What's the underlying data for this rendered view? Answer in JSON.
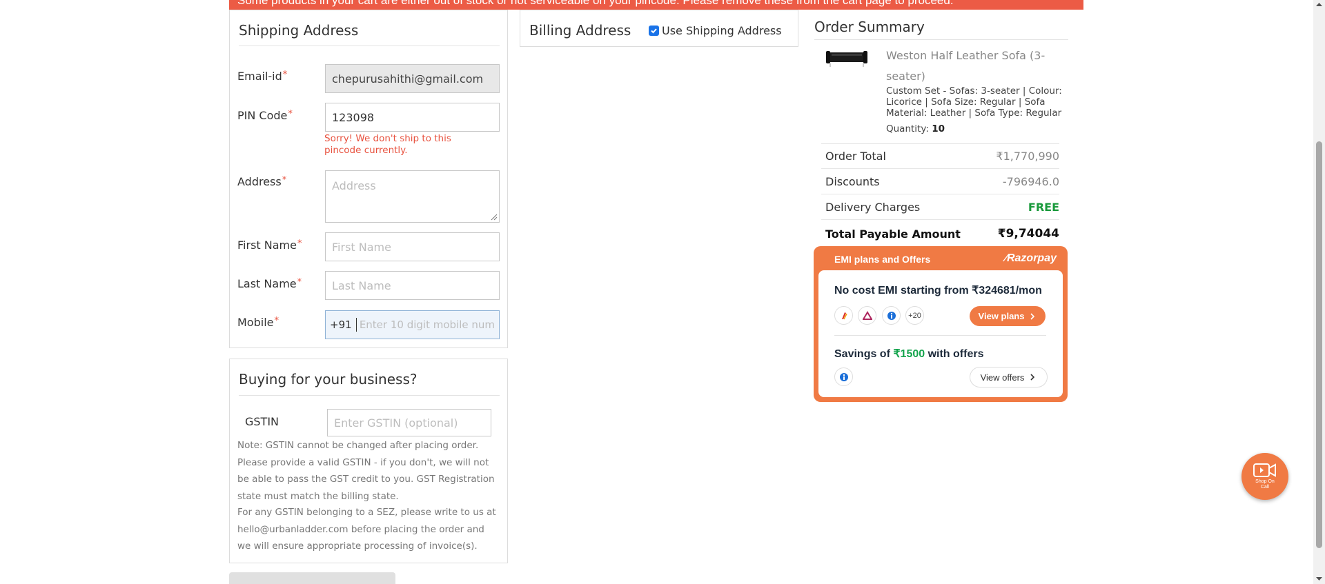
{
  "alert": {
    "text": "Some products in your cart are either out of stock or not serviceable on your pincode. Please remove these from the cart page to proceed."
  },
  "shipping": {
    "title": "Shipping Address",
    "email_label": "Email-id",
    "email_value": "chepurusahithi@gmail.com",
    "pin_label": "PIN Code",
    "pin_value": "123098",
    "pin_error": "Sorry! We don't ship to this pincode currently.",
    "address_label": "Address",
    "address_placeholder": "Address",
    "first_name_label": "First Name",
    "first_name_placeholder": "First Name",
    "last_name_label": "Last Name",
    "last_name_placeholder": "Last Name",
    "mobile_label": "Mobile",
    "mobile_prefix": "+91",
    "mobile_placeholder": "Enter 10 digit mobile num",
    "required_mark": "*"
  },
  "billing": {
    "title": "Billing Address",
    "checkbox_label": "Use Shipping Address",
    "checked": true
  },
  "business": {
    "title": "Buying for your business?",
    "gstin_label": "GSTIN",
    "gstin_placeholder": "Enter GSTIN (optional)",
    "note_1": "Note: GSTIN cannot be changed after placing order. Please provide a valid GSTIN - if you don't, we will not be able to pass the GST credit to you. GST Registration state must match the billing state.",
    "note_2": "For any GSTIN belonging to a SEZ, please write to us at hello@urbanladder.com before placing the order and we will ensure appropriate processing of invoice(s)."
  },
  "summary": {
    "title": "Order Summary",
    "product_name": "Weston Half Leather Sofa (3-seater)",
    "product_desc": "Custom Set - Sofas: 3-seater | Colour: Licorice | Sofa Size: Regular | Sofa Material: Leather | Sofa Type: Regular",
    "quantity_label": "Quantity:",
    "quantity_value": "10",
    "order_total_label": "Order Total",
    "order_total_value": "₹1,770,990",
    "discounts_label": "Discounts",
    "discounts_value": "-796946.0",
    "delivery_label": "Delivery Charges",
    "delivery_value": "FREE",
    "payable_label": "Total Payable Amount",
    "payable_value": "₹9,74044"
  },
  "emi": {
    "header": "EMI plans and Offers",
    "brand": "Razorpay",
    "no_cost_prefix": "No cost EMI starting from ",
    "no_cost_amount": "₹324681/mon",
    "more_banks": "+20",
    "view_plans": "View plans",
    "savings_prefix": "Savings of ",
    "savings_amount": "₹1500",
    "savings_suffix": " with offers",
    "view_offers": "View offers"
  },
  "floating": {
    "label": "Shop On Call"
  },
  "colors": {
    "accent": "#f07a44",
    "error": "#e8523f",
    "free": "#1a9a3c",
    "savings": "#14a44d"
  }
}
